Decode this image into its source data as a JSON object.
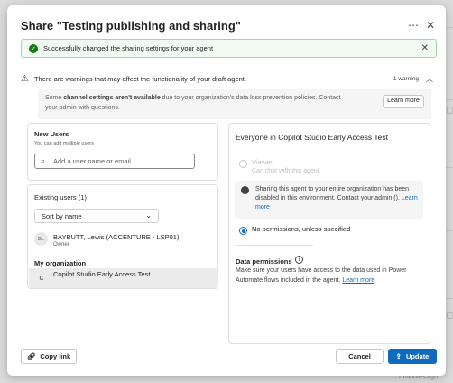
{
  "dialog": {
    "title": "Share \"Testing publishing and sharing\"",
    "more_icon": "ellipsis-icon",
    "close_icon": "close-icon"
  },
  "success_banner": {
    "text": "Successfully changed the sharing settings for your agent",
    "color": "#107c10"
  },
  "warning": {
    "text": "There are warnings that may affect the functionality of your draft agent.",
    "count": "1 warning",
    "detail_prefix": "Some ",
    "detail_bold": "channel settings aren't available",
    "detail_rest": " due to your organization's data loss prevention policies. Contact your admin with questions.",
    "learn_more_button": "Learn more"
  },
  "new_users": {
    "title": "New Users",
    "subtitle": "You can add multiple users",
    "search_placeholder": "Add a user name or email"
  },
  "existing_users": {
    "title": "Existing users (1)",
    "sort_value": "Sort by name",
    "users": [
      {
        "initials": "BL",
        "name": "BAYBUTT, Lewis (ACCENTURE - LSP01)",
        "role": "Owner"
      }
    ],
    "org_heading": "My organization",
    "org_initial": "C",
    "org_name": "Copilot Studio Early Access Test"
  },
  "right_panel": {
    "title": "Everyone in Copilot Studio Early Access Test",
    "viewer_label": "Viewer",
    "viewer_sub": "Can chat with this agent.",
    "info_text": "Sharing this agent to your entire organization has been disabled in this environment. Contact your admin ().",
    "info_link": "Learn more",
    "no_permissions_label": "No permissions, unless specified",
    "data_permissions_title": "Data permissions",
    "data_permissions_text": "Make sure your users have access to the data used in Power Automate flows included in the agent.",
    "data_permissions_link": "Learn more"
  },
  "footer": {
    "copy_link": "Copy link",
    "cancel": "Cancel",
    "update": "Update",
    "accent": "#0f6cbd"
  },
  "background": {
    "timestamp": "7 minutes ago"
  }
}
